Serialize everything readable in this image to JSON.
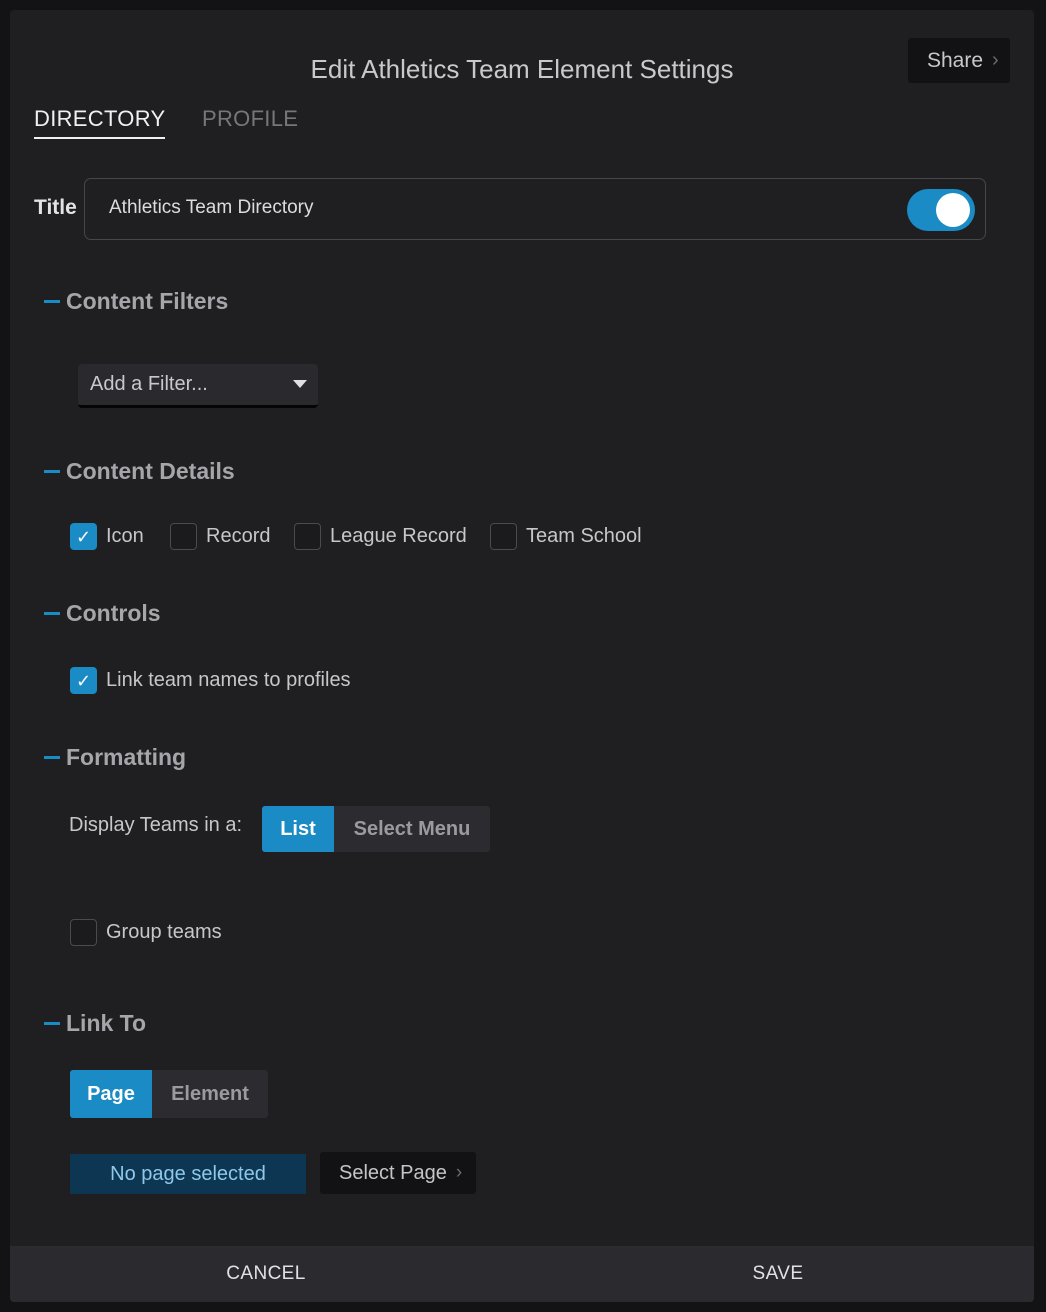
{
  "header": {
    "title": "Edit Athletics Team Element Settings",
    "share_label": "Share",
    "share_chevron": "›"
  },
  "tabs": [
    {
      "label": "DIRECTORY",
      "active": true
    },
    {
      "label": "PROFILE",
      "active": false
    }
  ],
  "title_field": {
    "label": "Title",
    "value": "Athletics Team Directory",
    "toggle_on": true
  },
  "sections": {
    "content_filters": {
      "title": "Content Filters",
      "filter_placeholder": "Add a Filter..."
    },
    "content_details": {
      "title": "Content Details",
      "options": [
        {
          "label": "Icon",
          "checked": true
        },
        {
          "label": "Record",
          "checked": false
        },
        {
          "label": "League Record",
          "checked": false
        },
        {
          "label": "Team School",
          "checked": false
        }
      ]
    },
    "controls": {
      "title": "Controls",
      "options": [
        {
          "label": "Link team names to profiles",
          "checked": true
        }
      ]
    },
    "formatting": {
      "title": "Formatting",
      "display_label": "Display Teams in a:",
      "display_options": [
        {
          "label": "List",
          "active": true
        },
        {
          "label": "Select Menu",
          "active": false
        }
      ],
      "group_teams": {
        "label": "Group teams",
        "checked": false
      }
    },
    "link_to": {
      "title": "Link To",
      "link_options": [
        {
          "label": "Page",
          "active": true
        },
        {
          "label": "Element",
          "active": false
        }
      ],
      "no_page_text": "No page selected",
      "select_page_label": "Select Page",
      "select_page_chevron": "›"
    }
  },
  "footer": {
    "cancel_label": "CANCEL",
    "save_label": "SAVE"
  },
  "colors": {
    "accent": "#1a8bc4",
    "modal_bg": "#1f1f22",
    "footer_bg": "#2b2b2f"
  },
  "icons": {
    "checkmark": "check-icon",
    "dropdown": "caret-down-icon",
    "chevron": "chevron-right-icon",
    "collapse": "minus-icon"
  }
}
